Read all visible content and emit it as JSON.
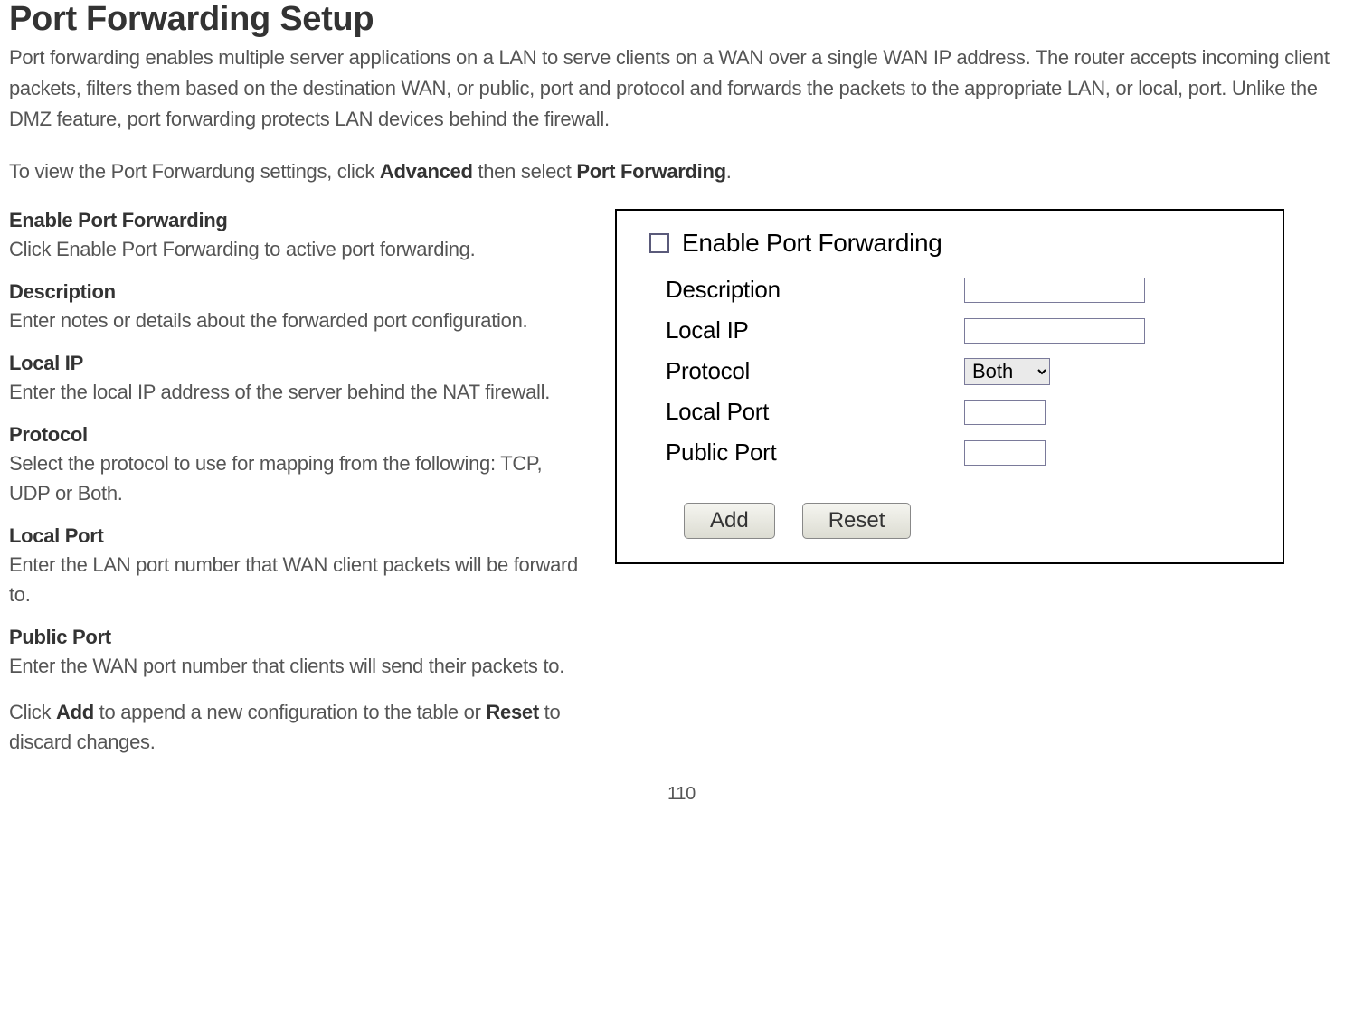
{
  "page": {
    "title": "Port Forwarding Setup",
    "intro": "Port forwarding enables multiple server applications on a LAN to serve clients on a WAN over a single WAN IP address. The router accepts incoming client packets, filters them based on the destination WAN, or public, port and protocol and forwards the packets to the appropriate LAN, or local, port. Unlike the DMZ feature, port forwarding protects LAN devices behind the firewall.",
    "nav_pre": "To view the Port Forwardung settings, click ",
    "nav_b1": "Advanced",
    "nav_mid": " then select ",
    "nav_b2": "Port Forwarding",
    "nav_end": ".",
    "page_number": "110"
  },
  "fields": {
    "enable": {
      "heading": "Enable Port Forwarding",
      "desc": "Click Enable Port Forwarding to active port forwarding."
    },
    "description": {
      "heading": "Description",
      "desc": "Enter notes or details about the forwarded port configuration."
    },
    "local_ip": {
      "heading": "Local IP",
      "desc": "Enter the local IP address of the server behind the NAT firewall."
    },
    "protocol": {
      "heading": "Protocol",
      "desc": "Select the protocol to use for mapping from the following: TCP, UDP or Both."
    },
    "local_port": {
      "heading": "Local Port",
      "desc": "Enter the LAN port number that WAN client packets will be forward to."
    },
    "public_port": {
      "heading": "Public Port",
      "desc": "Enter the WAN port number that clients will send their packets to."
    }
  },
  "footer": {
    "p1a": "Click ",
    "p1b": "Add",
    "p1c": " to append a new configuration to the table or ",
    "p1d": "Reset",
    "p1e": " to discard changes."
  },
  "shot": {
    "enable_label": "Enable Port Forwarding",
    "description_label": "Description",
    "local_ip_label": "Local IP",
    "protocol_label": "Protocol",
    "protocol_value": "Both",
    "local_port_label": "Local Port",
    "public_port_label": "Public Port",
    "btn_add": "Add",
    "btn_reset": "Reset"
  }
}
